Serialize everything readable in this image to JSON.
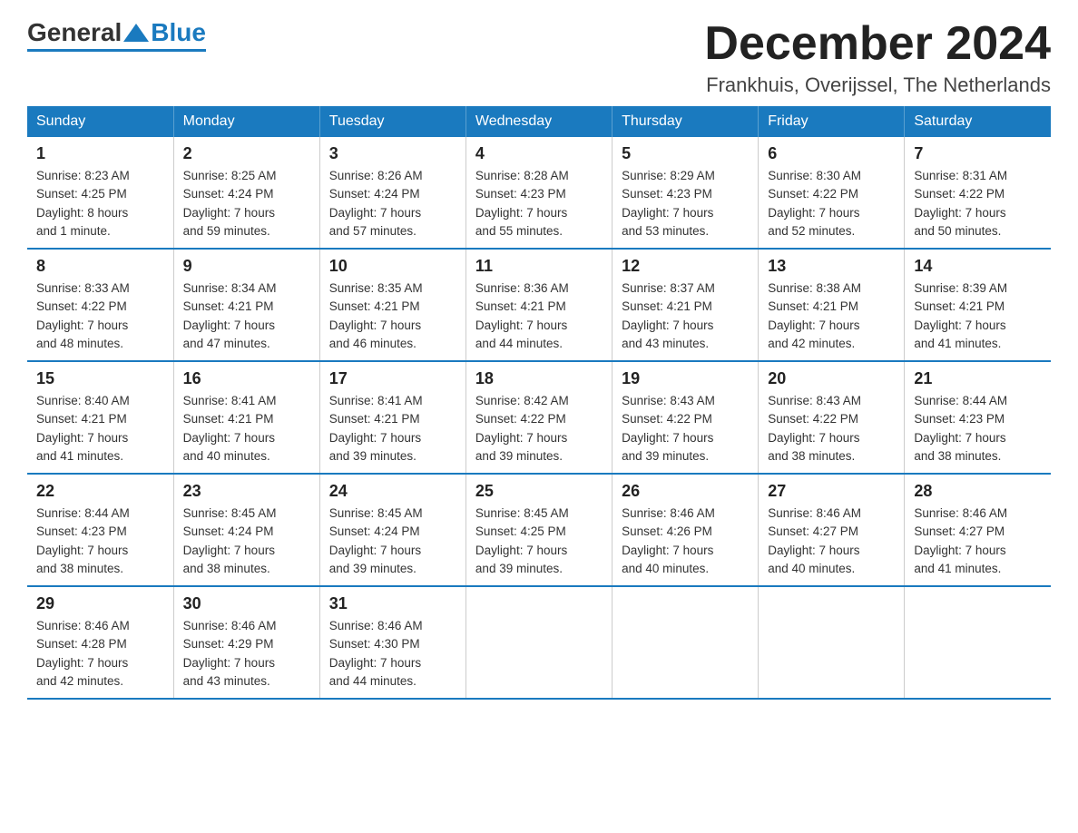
{
  "logo": {
    "general": "General",
    "blue": "Blue"
  },
  "header": {
    "title": "December 2024",
    "location": "Frankhuis, Overijssel, The Netherlands"
  },
  "days_of_week": [
    "Sunday",
    "Monday",
    "Tuesday",
    "Wednesday",
    "Thursday",
    "Friday",
    "Saturday"
  ],
  "weeks": [
    [
      {
        "day": "1",
        "sunrise": "8:23 AM",
        "sunset": "4:25 PM",
        "daylight": "8 hours and 1 minute."
      },
      {
        "day": "2",
        "sunrise": "8:25 AM",
        "sunset": "4:24 PM",
        "daylight": "7 hours and 59 minutes."
      },
      {
        "day": "3",
        "sunrise": "8:26 AM",
        "sunset": "4:24 PM",
        "daylight": "7 hours and 57 minutes."
      },
      {
        "day": "4",
        "sunrise": "8:28 AM",
        "sunset": "4:23 PM",
        "daylight": "7 hours and 55 minutes."
      },
      {
        "day": "5",
        "sunrise": "8:29 AM",
        "sunset": "4:23 PM",
        "daylight": "7 hours and 53 minutes."
      },
      {
        "day": "6",
        "sunrise": "8:30 AM",
        "sunset": "4:22 PM",
        "daylight": "7 hours and 52 minutes."
      },
      {
        "day": "7",
        "sunrise": "8:31 AM",
        "sunset": "4:22 PM",
        "daylight": "7 hours and 50 minutes."
      }
    ],
    [
      {
        "day": "8",
        "sunrise": "8:33 AM",
        "sunset": "4:22 PM",
        "daylight": "7 hours and 48 minutes."
      },
      {
        "day": "9",
        "sunrise": "8:34 AM",
        "sunset": "4:21 PM",
        "daylight": "7 hours and 47 minutes."
      },
      {
        "day": "10",
        "sunrise": "8:35 AM",
        "sunset": "4:21 PM",
        "daylight": "7 hours and 46 minutes."
      },
      {
        "day": "11",
        "sunrise": "8:36 AM",
        "sunset": "4:21 PM",
        "daylight": "7 hours and 44 minutes."
      },
      {
        "day": "12",
        "sunrise": "8:37 AM",
        "sunset": "4:21 PM",
        "daylight": "7 hours and 43 minutes."
      },
      {
        "day": "13",
        "sunrise": "8:38 AM",
        "sunset": "4:21 PM",
        "daylight": "7 hours and 42 minutes."
      },
      {
        "day": "14",
        "sunrise": "8:39 AM",
        "sunset": "4:21 PM",
        "daylight": "7 hours and 41 minutes."
      }
    ],
    [
      {
        "day": "15",
        "sunrise": "8:40 AM",
        "sunset": "4:21 PM",
        "daylight": "7 hours and 41 minutes."
      },
      {
        "day": "16",
        "sunrise": "8:41 AM",
        "sunset": "4:21 PM",
        "daylight": "7 hours and 40 minutes."
      },
      {
        "day": "17",
        "sunrise": "8:41 AM",
        "sunset": "4:21 PM",
        "daylight": "7 hours and 39 minutes."
      },
      {
        "day": "18",
        "sunrise": "8:42 AM",
        "sunset": "4:22 PM",
        "daylight": "7 hours and 39 minutes."
      },
      {
        "day": "19",
        "sunrise": "8:43 AM",
        "sunset": "4:22 PM",
        "daylight": "7 hours and 39 minutes."
      },
      {
        "day": "20",
        "sunrise": "8:43 AM",
        "sunset": "4:22 PM",
        "daylight": "7 hours and 38 minutes."
      },
      {
        "day": "21",
        "sunrise": "8:44 AM",
        "sunset": "4:23 PM",
        "daylight": "7 hours and 38 minutes."
      }
    ],
    [
      {
        "day": "22",
        "sunrise": "8:44 AM",
        "sunset": "4:23 PM",
        "daylight": "7 hours and 38 minutes."
      },
      {
        "day": "23",
        "sunrise": "8:45 AM",
        "sunset": "4:24 PM",
        "daylight": "7 hours and 38 minutes."
      },
      {
        "day": "24",
        "sunrise": "8:45 AM",
        "sunset": "4:24 PM",
        "daylight": "7 hours and 39 minutes."
      },
      {
        "day": "25",
        "sunrise": "8:45 AM",
        "sunset": "4:25 PM",
        "daylight": "7 hours and 39 minutes."
      },
      {
        "day": "26",
        "sunrise": "8:46 AM",
        "sunset": "4:26 PM",
        "daylight": "7 hours and 40 minutes."
      },
      {
        "day": "27",
        "sunrise": "8:46 AM",
        "sunset": "4:27 PM",
        "daylight": "7 hours and 40 minutes."
      },
      {
        "day": "28",
        "sunrise": "8:46 AM",
        "sunset": "4:27 PM",
        "daylight": "7 hours and 41 minutes."
      }
    ],
    [
      {
        "day": "29",
        "sunrise": "8:46 AM",
        "sunset": "4:28 PM",
        "daylight": "7 hours and 42 minutes."
      },
      {
        "day": "30",
        "sunrise": "8:46 AM",
        "sunset": "4:29 PM",
        "daylight": "7 hours and 43 minutes."
      },
      {
        "day": "31",
        "sunrise": "8:46 AM",
        "sunset": "4:30 PM",
        "daylight": "7 hours and 44 minutes."
      },
      null,
      null,
      null,
      null
    ]
  ],
  "labels": {
    "sunrise": "Sunrise:",
    "sunset": "Sunset:",
    "daylight": "Daylight:"
  }
}
